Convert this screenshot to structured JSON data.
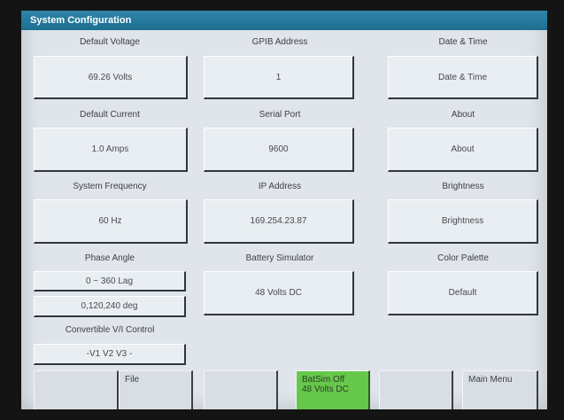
{
  "title": "System Configuration",
  "columns": [
    {
      "fields": [
        {
          "label": "Default Voltage",
          "value": "69.26 Volts"
        },
        {
          "label": "Default Current",
          "value": "1.0 Amps"
        },
        {
          "label": "System Frequency",
          "value": "60 Hz"
        }
      ]
    },
    {
      "fields": [
        {
          "label": "GPIB Address",
          "value": "1"
        },
        {
          "label": "Serial Port",
          "value": "9600"
        },
        {
          "label": "IP Address",
          "value": "169.254.23.87"
        }
      ]
    },
    {
      "fields": [
        {
          "label": "Date & Time",
          "value": "Date & Time"
        },
        {
          "label": "About",
          "value": "About"
        },
        {
          "label": "Brightness",
          "value": "Brightness"
        }
      ]
    }
  ],
  "phase_angle": {
    "label": "Phase Angle",
    "range": "0 ~ 360 Lag",
    "phases": "0,120,240 deg"
  },
  "battery_simulator": {
    "label": "Battery Simulator",
    "value": "48 Volts DC"
  },
  "color_palette": {
    "label": "Color Palette",
    "value": "Default"
  },
  "convertible_control": {
    "label": "Convertible V/I Control",
    "value": "-V1  V2  V3 -"
  },
  "softkeys": [
    {
      "label": ""
    },
    {
      "label": "File"
    },
    {
      "label": ""
    },
    {
      "label_line1": "BatSim Off",
      "label_line2": "48 Volts DC",
      "active_color": "#66c84a"
    },
    {
      "label": ""
    },
    {
      "label": "Main Menu"
    }
  ]
}
